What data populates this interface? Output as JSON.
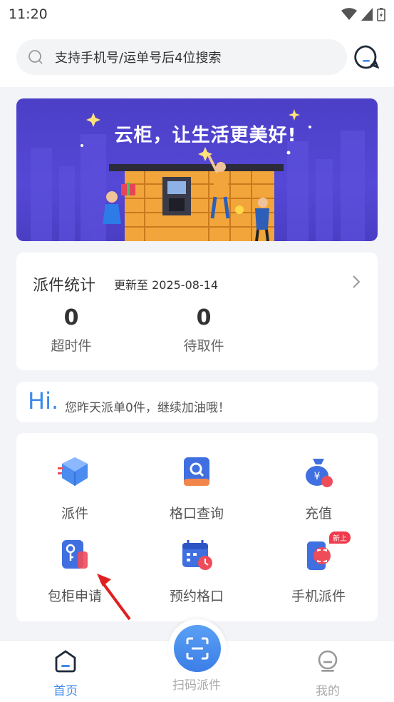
{
  "status_bar": {
    "time": "11:20"
  },
  "search": {
    "placeholder": "支持手机号/运单号后4位搜索"
  },
  "banner": {
    "slogan": "云柜，让生活更美好!"
  },
  "stats": {
    "title": "派件统计",
    "updated": "更新至 2025-08-14",
    "items": [
      {
        "value": "0",
        "label": "超时件"
      },
      {
        "value": "0",
        "label": "待取件"
      }
    ]
  },
  "greeting": {
    "hi": "Hi.",
    "message": "您昨天派单0件，继续加油哦！"
  },
  "menu": {
    "items": [
      {
        "label": "派件",
        "icon": "package-icon"
      },
      {
        "label": "格口查询",
        "icon": "search-locker-icon"
      },
      {
        "label": "充值",
        "icon": "money-bag-icon"
      },
      {
        "label": "包柜申请",
        "icon": "key-card-icon"
      },
      {
        "label": "预约格口",
        "icon": "calendar-clock-icon"
      },
      {
        "label": "手机派件",
        "icon": "phone-dispatch-icon",
        "badge": "新上"
      }
    ]
  },
  "tabbar": {
    "items": [
      {
        "label": "首页",
        "active": true
      },
      {
        "label": "扫码派件",
        "active": false
      },
      {
        "label": "我的",
        "active": false
      }
    ]
  },
  "colors": {
    "accent": "#3f8be9",
    "banner": "#4b3fc7",
    "inactive": "#aaaaaa"
  }
}
